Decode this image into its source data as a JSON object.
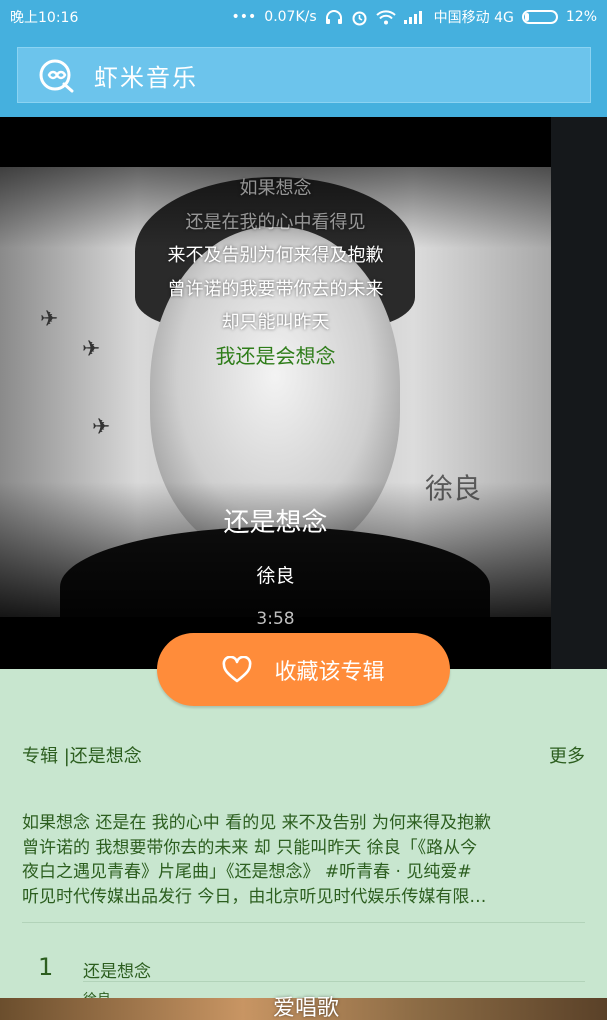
{
  "status_bar": {
    "time": "晚上10:16",
    "network_speed": "0.07K/s",
    "carrier": "中国移动 4G",
    "battery": "12%",
    "battery_level": 0.12
  },
  "header": {
    "logo_icon": "xiami-logo-icon",
    "title": "虾米音乐"
  },
  "player": {
    "cover_text": "徐良",
    "lyrics": [
      "如果想念",
      "还是在我的心中看得见",
      "来不及告别为何来得及抱歉",
      "曾许诺的我要带你去的未来",
      "却只能叫昨天",
      "我还是会想念"
    ],
    "active_lyric_index": 5,
    "song_title": "还是想念",
    "artist": "徐良",
    "duration": "3:58"
  },
  "favorite_button": {
    "icon": "heart-icon",
    "label": "收藏该专辑"
  },
  "album": {
    "label": "专辑 |还是想念",
    "more": "更多",
    "description_lines": [
      "如果想念 还是在 我的心中 看的见 来不及告别 为何来得及抱歉",
      "曾许诺的 我想要带你去的未来 却 只能叫昨天 徐良「《路从今",
      "夜白之遇见青春》片尾曲」《还是想念》 #听青春 · 见纯爱#",
      "听见时代传媒出品发行 今日，由北京听见时代娱乐传媒有限…"
    ]
  },
  "tracks": [
    {
      "number": "1",
      "name": "还是想念",
      "artist": "徐良"
    }
  ],
  "watermark": "爱唱歌",
  "colors": {
    "status_bar": "#45b0de",
    "header": "#6cc4ec",
    "accent_orange": "#ff8c3a",
    "lyric_active": "#2f7d1a",
    "background_green": "#c8e6cf",
    "text_green": "#2c5e1f"
  }
}
